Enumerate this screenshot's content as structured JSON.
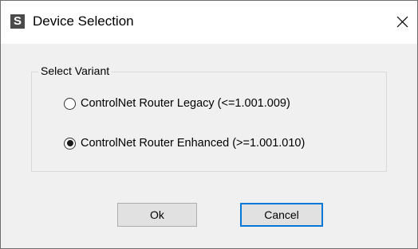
{
  "window": {
    "title": "Device Selection",
    "app_icon": "S",
    "close_icon": "close-icon"
  },
  "group": {
    "legend": "Select Variant",
    "options": [
      {
        "label": "ControlNet Router Legacy (<=1.001.009)",
        "selected": false
      },
      {
        "label": "ControlNet Router Enhanced (>=1.001.010)",
        "selected": true
      }
    ]
  },
  "buttons": {
    "ok_label": "Ok",
    "cancel_label": "Cancel"
  },
  "colors": {
    "focus_border": "#0078d7",
    "dialog_bg": "#f0f0f0"
  }
}
